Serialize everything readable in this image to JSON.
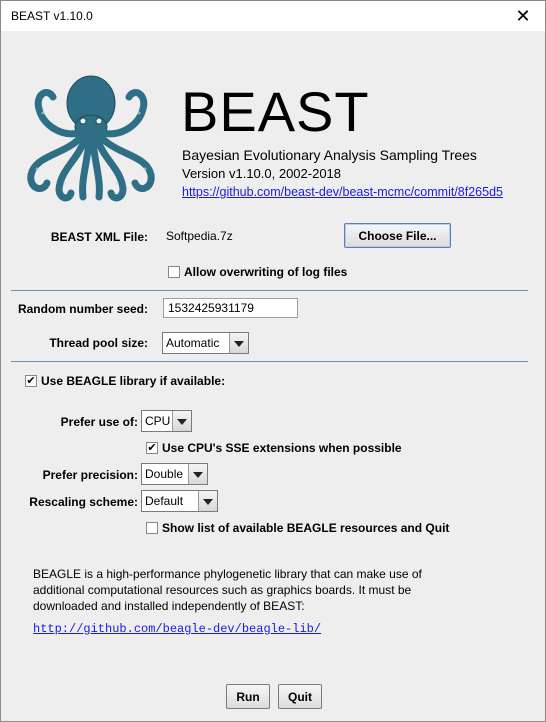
{
  "window": {
    "title": "BEAST v1.10.0",
    "close_glyph": "✕"
  },
  "header": {
    "app_name": "BEAST",
    "subtitle": "Bayesian Evolutionary Analysis Sampling Trees",
    "version": "Version v1.10.0, 2002-2018",
    "commit_link": "https://github.com/beast-dev/beast-mcmc/commit/8f265d5"
  },
  "xml_file": {
    "label": "BEAST XML File:",
    "value": "Softpedia.7z",
    "choose_button": "Choose File..."
  },
  "overwrite": {
    "label": "Allow overwriting of log files",
    "checked": false
  },
  "seed": {
    "label": "Random number seed:",
    "value": "1532425931179"
  },
  "thread_pool": {
    "label": "Thread pool size:",
    "value": "Automatic"
  },
  "beagle": {
    "use_label": "Use BEAGLE library if available:",
    "use_checked": true,
    "prefer_use": {
      "label": "Prefer use of:",
      "value": "CPU"
    },
    "sse": {
      "label": "Use CPU's SSE extensions when possible",
      "checked": true
    },
    "precision": {
      "label": "Prefer precision:",
      "value": "Double"
    },
    "rescaling": {
      "label": "Rescaling scheme:",
      "value": "Default"
    },
    "show_resources": {
      "label": "Show list of available BEAGLE resources and Quit",
      "checked": false
    },
    "description": "BEAGLE is a high-performance phylogenetic library that can make use of additional computational resources such as graphics boards. It must be downloaded and installed independently of BEAST:",
    "link": "http://github.com/beagle-dev/beagle-lib/"
  },
  "buttons": {
    "run": "Run",
    "quit": "Quit"
  },
  "colors": {
    "separator": "#6d8fbf",
    "link": "#1a1ae6",
    "logo": "#2f6f86"
  }
}
